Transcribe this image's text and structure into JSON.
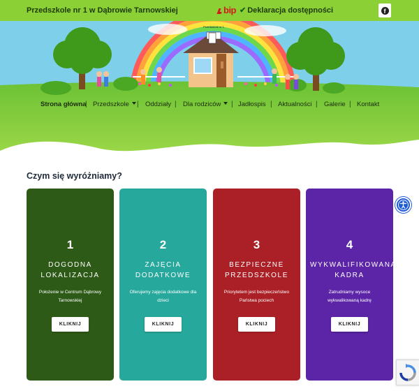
{
  "header": {
    "site_title": "Przedszkole nr 1 w Dąbrowie Tarnowskiej",
    "bip_label": "bip",
    "accessibility_link": "Deklaracja dostępności",
    "facebook_icon": "facebook-icon"
  },
  "hero": {
    "house_sign": "Przedszkole nr 1"
  },
  "nav": {
    "items": [
      {
        "label": "Strona główna",
        "active": true,
        "dropdown": false
      },
      {
        "label": "Przedszkole",
        "active": false,
        "dropdown": true
      },
      {
        "label": "Oddziały",
        "active": false,
        "dropdown": false
      },
      {
        "label": "Dla rodziców",
        "active": false,
        "dropdown": true
      },
      {
        "label": "Jadłospis",
        "active": false,
        "dropdown": false
      },
      {
        "label": "Aktualności",
        "active": false,
        "dropdown": false
      },
      {
        "label": "Galerie",
        "active": false,
        "dropdown": false
      },
      {
        "label": "Kontakt",
        "active": false,
        "dropdown": false
      }
    ]
  },
  "section": {
    "heading": "Czym się wyróżniamy?"
  },
  "cards": [
    {
      "number": "1",
      "title_line1": "DOGODNA",
      "title_line2": "LOKALIZACJA",
      "desc_line1": "Położenie w Centrum Dąbrowy",
      "desc_line2": "Tarnowskiej",
      "button": "KLIKNIJ",
      "color": "#2e5a17"
    },
    {
      "number": "2",
      "title_line1": "ZAJĘCIA",
      "title_line2": "DODATKOWE",
      "desc_line1": "Oferujemy zajęcia dodatkowe dla",
      "desc_line2": "dzieci",
      "button": "KLIKNIJ",
      "color": "#27a89c"
    },
    {
      "number": "3",
      "title_line1": "BEZPIECZNE",
      "title_line2": "PRZEDSZKOLE",
      "desc_line1": "Priorytetem jest bezpieczeństwo",
      "desc_line2": "Państwa pociech",
      "button": "KLIKNIJ",
      "color": "#aa2026"
    },
    {
      "number": "4",
      "title_line1": "WYKWALIFIKOWANA",
      "title_line2": "KADRA",
      "desc_line1": "Zatrudniamy wysoce",
      "desc_line2": "wykwalikowaną kadrę",
      "button": "KLIKNIJ",
      "color": "#5c24a6"
    }
  ],
  "widgets": {
    "accessibility_icon": "accessibility-icon",
    "recaptcha_icon": "recaptcha-icon"
  }
}
